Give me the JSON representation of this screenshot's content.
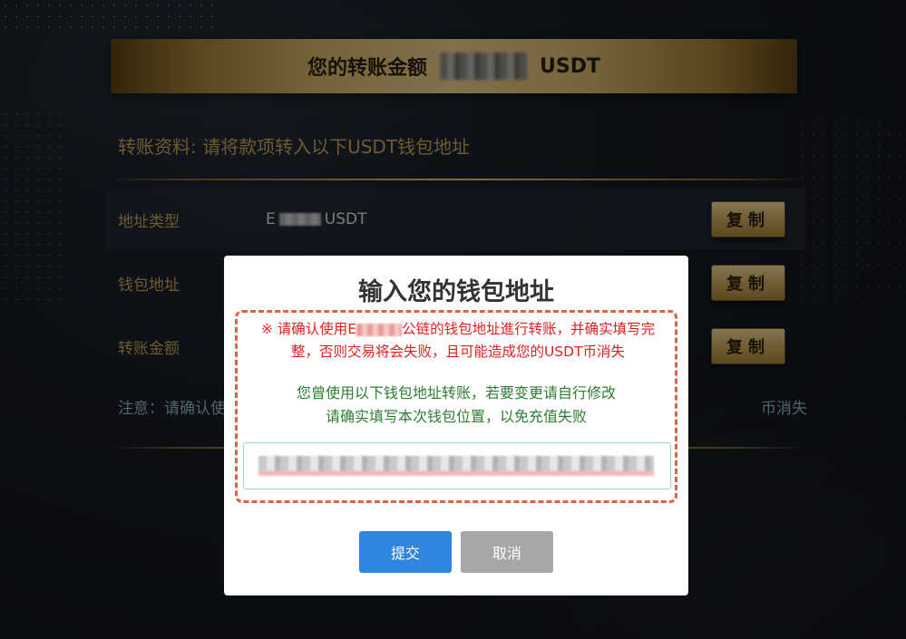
{
  "banner": {
    "title": "您的转账金额",
    "unit": "USDT"
  },
  "transfer_info": {
    "heading": "转账资料: 请将款项转入以下USDT钱包地址",
    "rows": [
      {
        "label": "地址类型",
        "value_prefix": "E",
        "value_suffix": "USDT",
        "button": "复制"
      },
      {
        "label": "钱包地址",
        "button": "复制"
      },
      {
        "label": "转账金额",
        "button": "复制"
      }
    ],
    "note_start": "注意：请确认使",
    "note_end": "币消失"
  },
  "modal": {
    "title": "输入您的钱包地址",
    "warning_part1": "※ 请确认使用E",
    "warning_part2": "公链的钱包地址進行转账，并确实填写完整，否则交易将会失败，且可能造成您的USDT币消失",
    "hint_line1": "您曾使用以下钱包地址转账，若要变更请自行修改",
    "hint_line2": "请确实填写本次钱包位置，以免充值失败",
    "submit_label": "提交",
    "cancel_label": "取消"
  }
}
